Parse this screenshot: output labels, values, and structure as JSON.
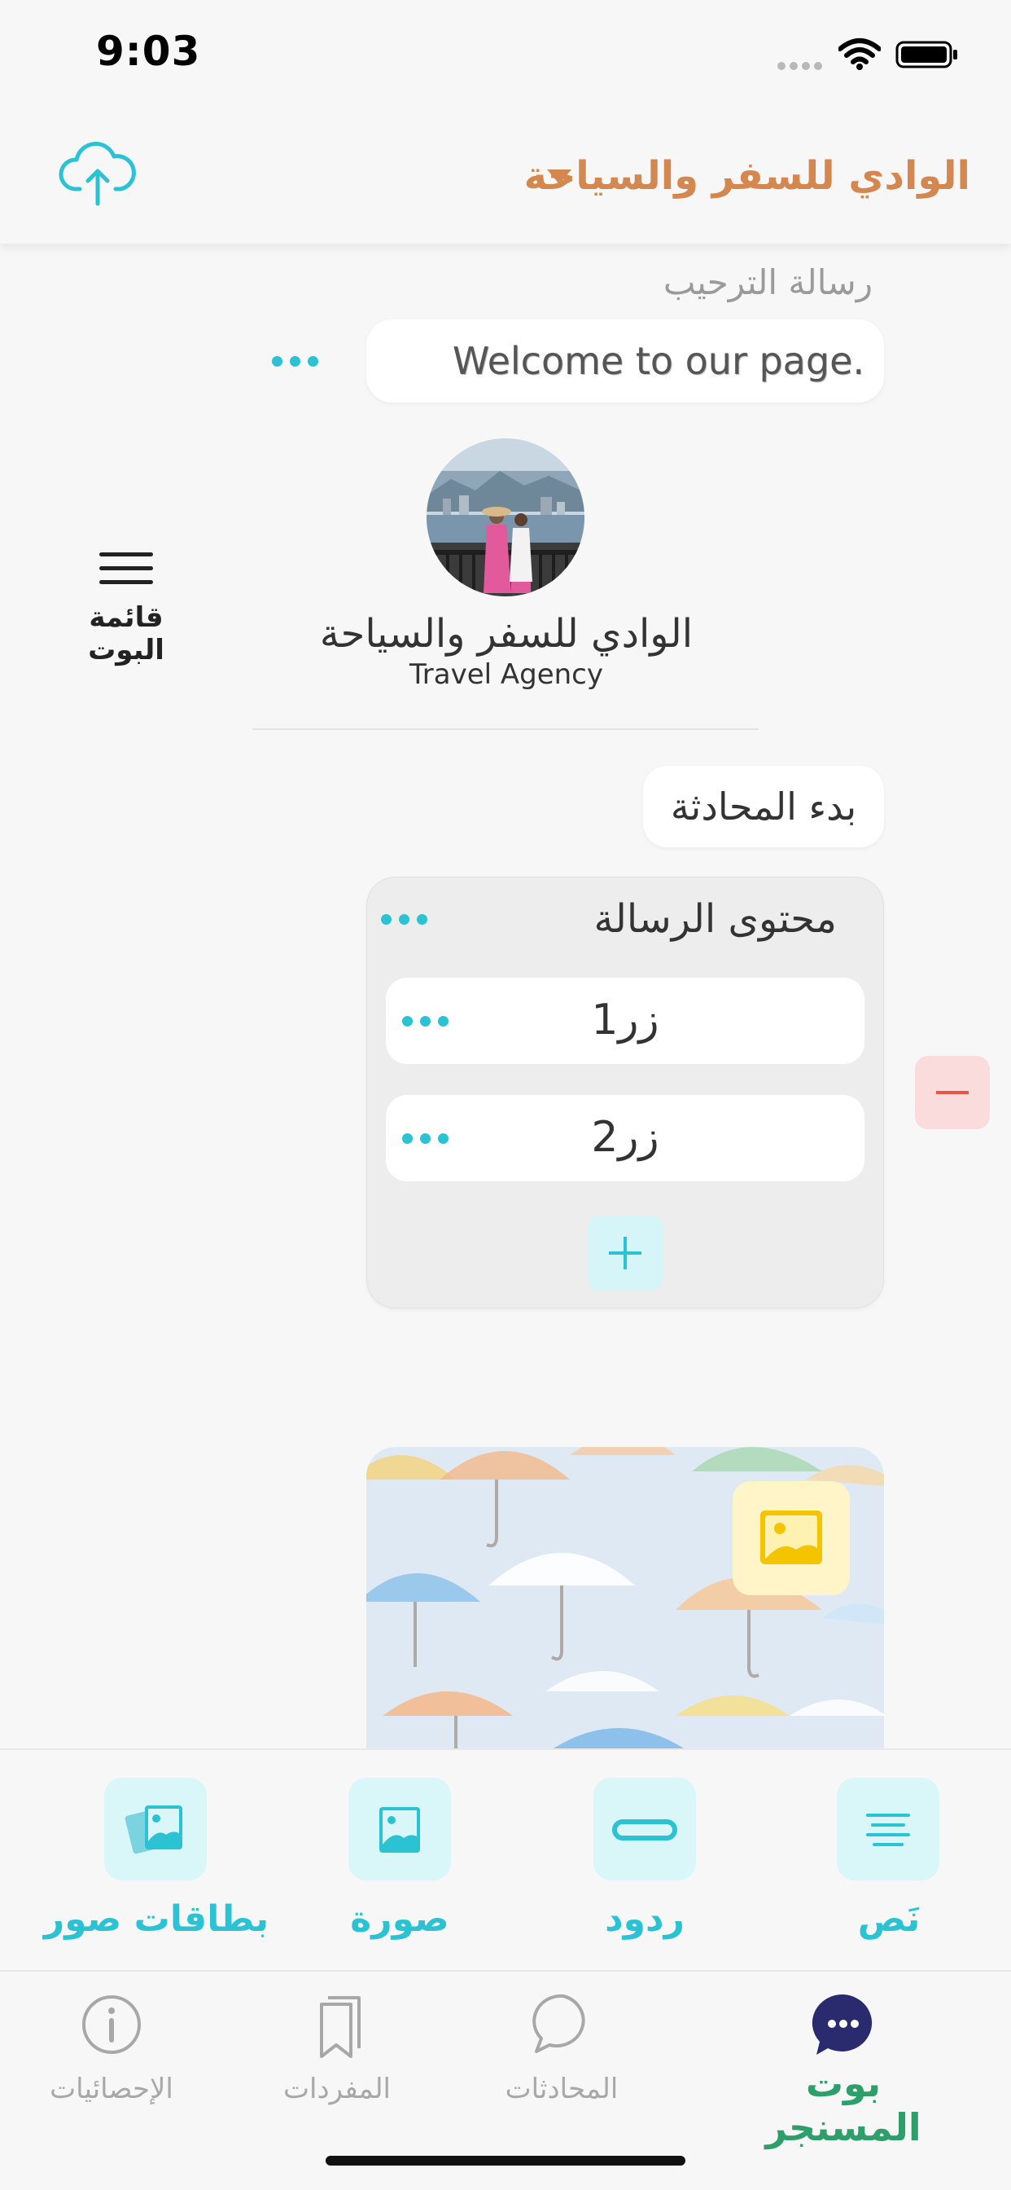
{
  "status_bar": {
    "time": "9:03"
  },
  "header": {
    "page_name": "الوادي للسفر والسياحة",
    "upload_icon": "cloud-upload-icon"
  },
  "welcome": {
    "label": "رسالة الترحيب",
    "message": "Welcome to our page."
  },
  "profile": {
    "name": "الوادي للسفر والسياحة",
    "category": "Travel Agency",
    "bot_menu_label": "قائمة البوت"
  },
  "conversation": {
    "start_label": "بدء المحادثة",
    "message_title": "محتوى الرسالة",
    "buttons": [
      {
        "label": "زر1"
      },
      {
        "label": "زر2"
      }
    ]
  },
  "tools": {
    "text": "نَص",
    "replies": "ردود",
    "image": "صورة",
    "image_cards": "بطاقات صور"
  },
  "tabs": {
    "messenger_bot": "بوت المسنجر",
    "conversations": "المحادثات",
    "vocabulary": "المفردات",
    "statistics": "الإحصائيات"
  },
  "colors": {
    "accent": "#2bc2d3",
    "brand": "#d4874f",
    "active_tab": "#2e9e6b",
    "danger": "#e5574a"
  }
}
